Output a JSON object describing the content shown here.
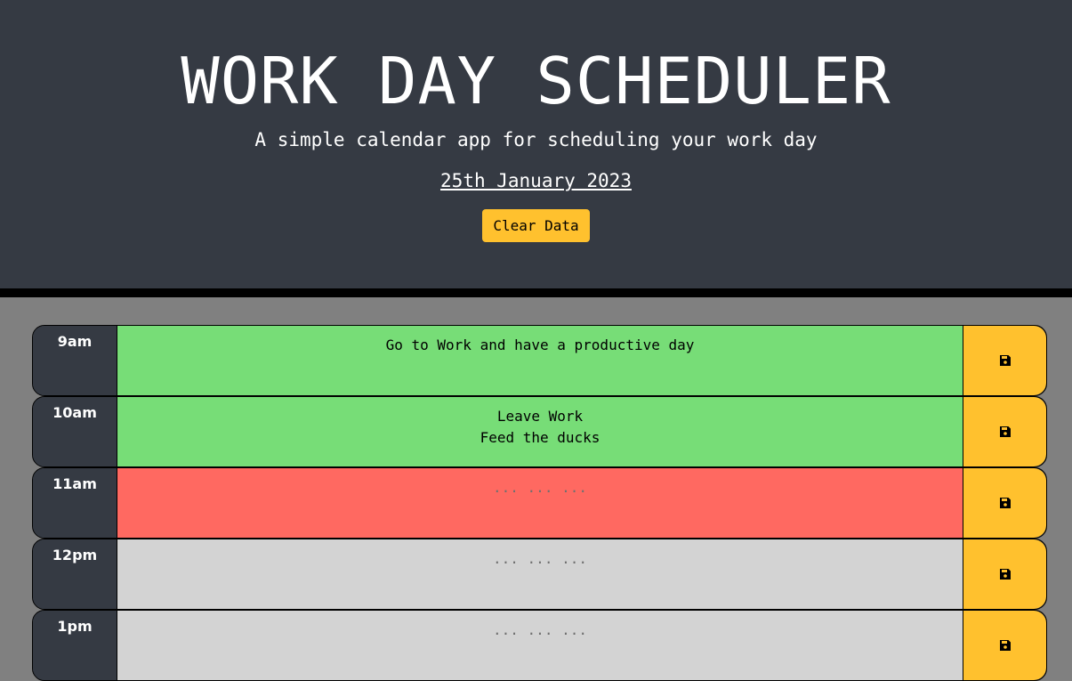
{
  "header": {
    "title": "WORK DAY SCHEDULER",
    "subtitle": "A simple calendar app for scheduling your work day",
    "current_day": "25th January 2023",
    "clear_label": "Clear Data"
  },
  "colors": {
    "header_bg": "#353a43",
    "page_bg": "#808080",
    "future": "#77dd77",
    "present": "#ff6961",
    "past": "#d3d3d3",
    "save_button": "#ffc12e"
  },
  "time_blocks": [
    {
      "hour": "9am",
      "status": "future",
      "text": "Go to Work and have a productive day",
      "placeholder": "... ... ...",
      "save_icon": "save-icon"
    },
    {
      "hour": "10am",
      "status": "future",
      "text": "Leave Work\nFeed the ducks",
      "placeholder": "... ... ...",
      "save_icon": "save-icon"
    },
    {
      "hour": "11am",
      "status": "present",
      "text": "",
      "placeholder": "... ... ...",
      "save_icon": "save-icon"
    },
    {
      "hour": "12pm",
      "status": "past",
      "text": "",
      "placeholder": "... ... ...",
      "save_icon": "save-icon"
    },
    {
      "hour": "1pm",
      "status": "past",
      "text": "",
      "placeholder": "... ... ...",
      "save_icon": "save-icon"
    }
  ]
}
